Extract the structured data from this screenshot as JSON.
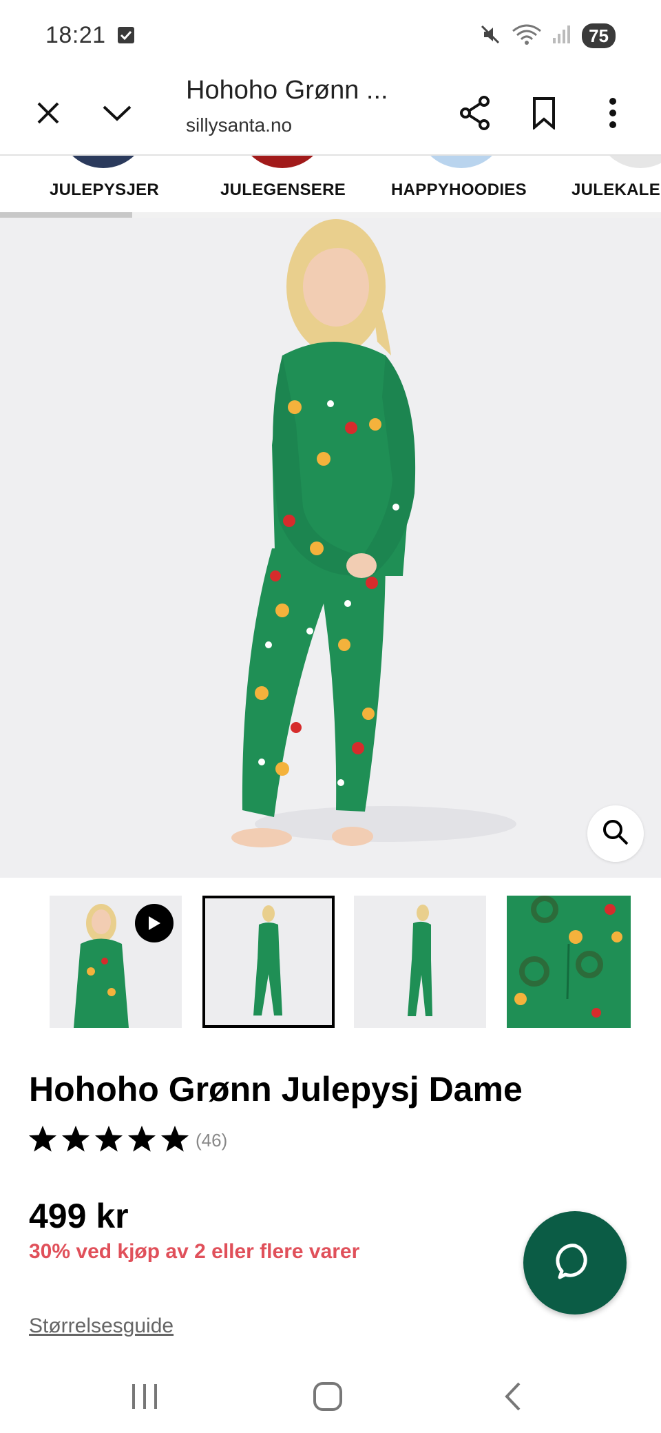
{
  "status_bar": {
    "time": "18:21",
    "battery": "75",
    "icons": [
      "checkbox-icon",
      "mute-icon",
      "wifi-icon",
      "signal-icon"
    ]
  },
  "browser": {
    "page_title": "Hohoho Grønn ...",
    "domain": "sillysanta.no",
    "icons": [
      "close-icon",
      "chevron-down-icon",
      "share-icon",
      "bookmark-icon",
      "more-icon"
    ]
  },
  "categories": [
    {
      "label": "JULEPYSJER",
      "arc_color": "#2b3a5c"
    },
    {
      "label": "JULEGENSERE",
      "arc_color": "#a11a1a"
    },
    {
      "label": "HAPPYHOODIES",
      "arc_color": "#b9d4ee"
    },
    {
      "label": "JULEKALENDER",
      "arc_color": "#e6e6e6"
    }
  ],
  "category_scroll_fraction": 0.2,
  "product": {
    "title": "Hohoho Grønn Julepysj Dame",
    "rating": 5,
    "review_count": "(46)",
    "price": "499 kr",
    "promo": "30% ved kjøp av 2 eller flere varer",
    "size_guide": "Størrelsesguide",
    "thumbnail_count": 4,
    "selected_thumbnail": 2
  },
  "colors": {
    "pajama_green": "#1f8f55",
    "promo_red": "#e0505a",
    "chat_green": "#0b5c45",
    "hero_background": "#efeff1"
  }
}
